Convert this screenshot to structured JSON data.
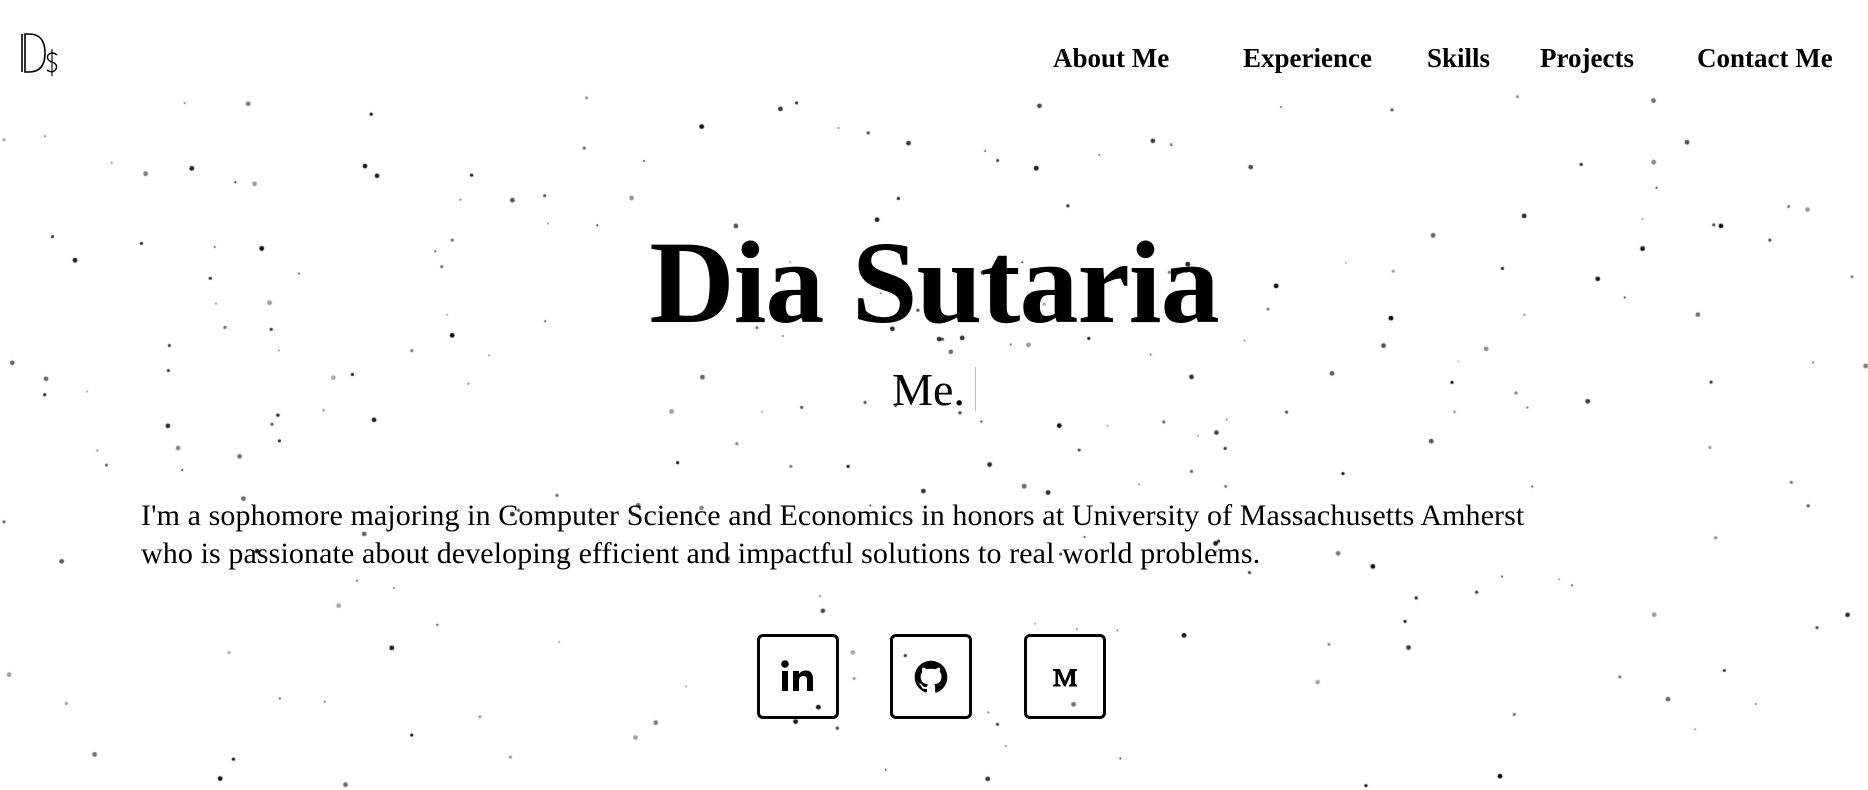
{
  "header": {
    "logo_icon": "ds-monogram-logo",
    "nav": [
      {
        "label": "About Me"
      },
      {
        "label": "Experience"
      },
      {
        "label": "Skills"
      },
      {
        "label": "Projects"
      },
      {
        "label": "Contact Me"
      }
    ]
  },
  "hero": {
    "name": "Dia Sutaria",
    "typed_text": "Me.",
    "bio_lines": [
      "I'm a sophomore majoring in Computer Science and Economics in honors at University of Massachusetts Amherst",
      "who is passionate about developing efficient and impactful solutions to real world problems."
    ]
  },
  "social": [
    {
      "icon": "linkedin-icon"
    },
    {
      "icon": "github-icon"
    },
    {
      "icon": "medium-icon"
    }
  ],
  "colors": {
    "background": "#ffffff",
    "text": "#000000",
    "particles": "#000000"
  }
}
